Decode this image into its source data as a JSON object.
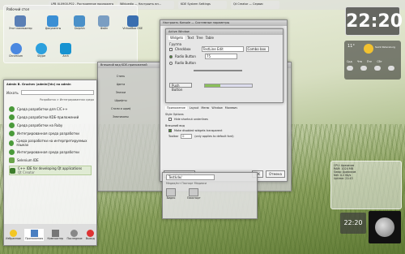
{
  "desktop": {
    "folder_title": "Рабочий стол",
    "icons": [
      {
        "label": "Этот компьютер",
        "color": "#5a7fb5"
      },
      {
        "label": "Документы",
        "color": "#3b8fd4"
      },
      {
        "label": "Dolphin",
        "color": "#4a90c8"
      },
      {
        "label": "Файл",
        "color": "#7a9ec2"
      },
      {
        "label": "VirtualBox OSE",
        "color": "#3a6fb0"
      },
      {
        "label": "Chromium",
        "color": "#4a88e0"
      },
      {
        "label": "Skype",
        "color": "#2ca0dd"
      },
      {
        "label": "Arch",
        "color": "#1793d1"
      }
    ]
  },
  "clock": {
    "time": "22:20"
  },
  "clock_small": {
    "time": "22:20"
  },
  "weather": {
    "temp": "11°",
    "city": "Saint Petersburg",
    "days": [
      "Срд",
      "Чтв",
      "Птн",
      "Сбт"
    ]
  },
  "launcher": {
    "user": "Admin В. Gruchev (admin@dv) на admin",
    "search_label": "Искать",
    "category": "Разработка > Интегрированная среда",
    "items": [
      "Среда разработки для C/C++",
      "Среда разработки KDE-приложений",
      "Среда разработки на Ruby",
      "Интегрированная среда разработки",
      "Среда разработки на интерпретируемых языках",
      "Интегрированная среда разработки",
      "Selenium IDE",
      "C++ IDE for developing Qt applications"
    ],
    "item_sub": "Qt Creator",
    "tabs": [
      "Избранное",
      "Приложения",
      "Компьютер",
      "Последние",
      "Выход"
    ]
  },
  "kde_settings": {
    "title": "Внешний вид KDE-приложений",
    "sidebar": [
      "Стиль",
      "Цвета",
      "Значки",
      "Шрифты",
      "Стили и шрифты GTK",
      "Эмотиконы",
      "Стили и шрифты GTK"
    ]
  },
  "style_window": {
    "title": "Настроить Konsole — Системные параметры",
    "tabs": [
      "Приложение",
      "Layout",
      "Меню",
      "Window",
      "Малевич",
      "Мини"
    ],
    "preview_title": "Active Window",
    "preview_tabs": [
      "Widgets",
      "Text",
      "Tree",
      "Table"
    ],
    "groupbox": "Группа",
    "checkbox": "Checkbox",
    "radio1": "Radio Button",
    "radio2": "Radio Button",
    "line_edit": "TestLine Edit",
    "combo": "Combo box",
    "spin": "75",
    "push": "Push Button",
    "progress": "0.32",
    "section1": "Style Options",
    "opt1": "Hide shortcut underlines",
    "section2": "Внешний вид",
    "opt2": "Make disabled widgets transparent",
    "toolbar": "Toolbar",
    "toolbar_value": "0",
    "toolbar_hint": "(only applies to default font)",
    "defaults_btn": "По умолчанию",
    "ok_btn": "OK",
    "cancel_btn": "Отмена"
  },
  "dolphin": {
    "path": "Testkde/",
    "places": [
      "Видео",
      "Паиспорт"
    ],
    "header": "Медиа/ест Паспорт Медиаси"
  },
  "system_monitor": {
    "lines": [
      "CPU: Арахисов",
      "RAM: 1024 МВ",
      "Swap: Арахисов",
      "Net: 0.2 Kb/s",
      "Uptime: 21:43"
    ]
  },
  "taskbar": {
    "items": [
      "LPB III-0900-P02 - Ростроенное приложение",
      "Wikipedia — Настроить вн...",
      "KDE System Settings",
      "Qt Creator — Сервис"
    ]
  }
}
